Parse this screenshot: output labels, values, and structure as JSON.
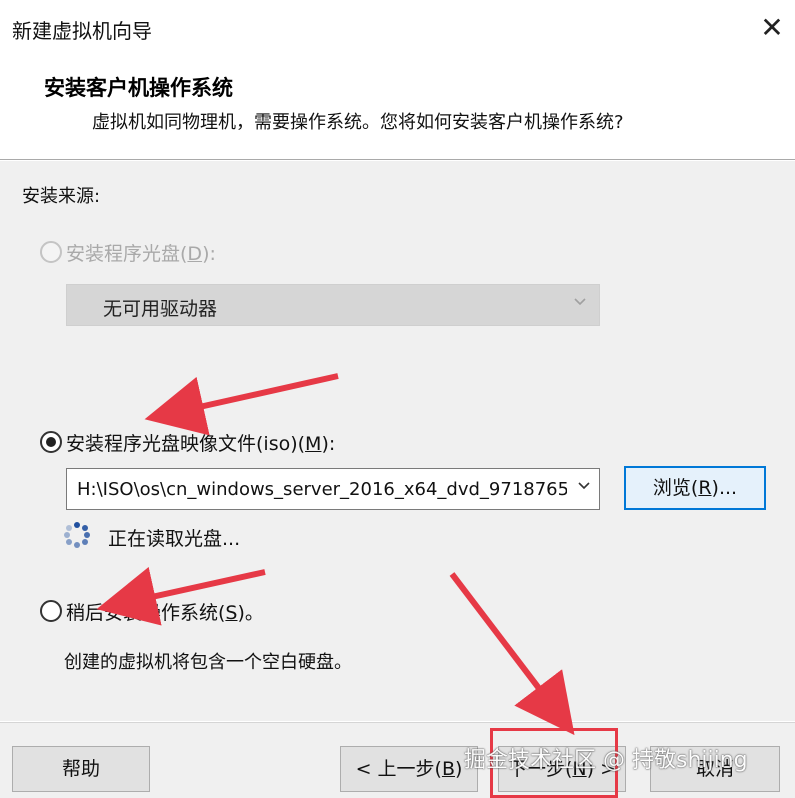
{
  "window": {
    "title": "新建虚拟机向导",
    "close_glyph": "✕"
  },
  "header": {
    "title": "安装客户机操作系统",
    "subtitle": "虚拟机如同物理机，需要操作系统。您将如何安装客户机操作系统?"
  },
  "install_source": {
    "label": "安装来源:",
    "options": [
      {
        "label_prefix": "安装程序光盘(",
        "mnemonic": "D",
        "label_suffix": "):",
        "selected": false,
        "enabled": false
      },
      {
        "label_prefix": "安装程序光盘映像文件(iso)(",
        "mnemonic": "M",
        "label_suffix": "):",
        "selected": true,
        "enabled": true
      },
      {
        "label_prefix": "稍后安装操作系统(",
        "mnemonic": "S",
        "label_suffix": ")。",
        "selected": false,
        "enabled": true
      }
    ],
    "disc_drive_value": "无可用驱动器",
    "iso_path_value": "H:\\ISO\\os\\cn_windows_server_2016_x64_dvd_9718765",
    "browse_button": {
      "prefix": "浏览(",
      "mnemonic": "R",
      "suffix": ")..."
    },
    "status_text": "正在读取光盘...",
    "later_description": "创建的虚拟机将包含一个空白硬盘。"
  },
  "footer": {
    "help": "帮助",
    "back": {
      "prefix": "< 上一步(",
      "mnemonic": "B",
      "suffix": ")"
    },
    "next": {
      "prefix": "下一步(",
      "mnemonic": "N",
      "suffix": ") >"
    },
    "cancel": "取消"
  },
  "watermark": "掘金技术社区 @ 持敬shijing",
  "colors": {
    "annotation_red": "#e63946",
    "dialog_bg": "#f0f0f0",
    "focus_blue": "#0078d7"
  },
  "icons": {
    "close": "close-icon",
    "dropdown": "chevron-down-icon",
    "status": "loading-spinner-icon"
  }
}
